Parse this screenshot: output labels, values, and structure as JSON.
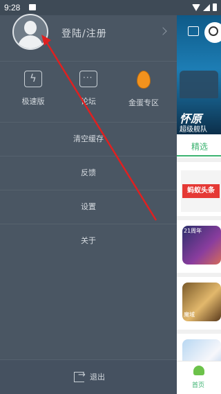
{
  "status_bar": {
    "time": "9:28"
  },
  "drawer": {
    "login_label": "登陆/注册",
    "quick_items": [
      {
        "label": "极速版",
        "icon": "lightning-icon"
      },
      {
        "label": "论坛",
        "icon": "chat-icon"
      },
      {
        "label": "金蛋专区",
        "icon": "golden-egg-icon"
      }
    ],
    "menu": [
      {
        "label": "清空缓存"
      },
      {
        "label": "反馈"
      },
      {
        "label": "设置"
      },
      {
        "label": "关于"
      }
    ],
    "logout_label": "退出"
  },
  "peek": {
    "banner_title": "怀原",
    "banner_subtitle": "超级舰队",
    "tab_label": "精选",
    "ad_label": "蚂蚁头条",
    "game1_badge": "21周年",
    "game2_badge": "魔域",
    "bottom_nav_label": "首页"
  },
  "colors": {
    "drawer_bg": "#4a5663",
    "accent_green": "#3cb371",
    "annotation_red": "#e02020",
    "egg_orange": "#f2921d"
  }
}
